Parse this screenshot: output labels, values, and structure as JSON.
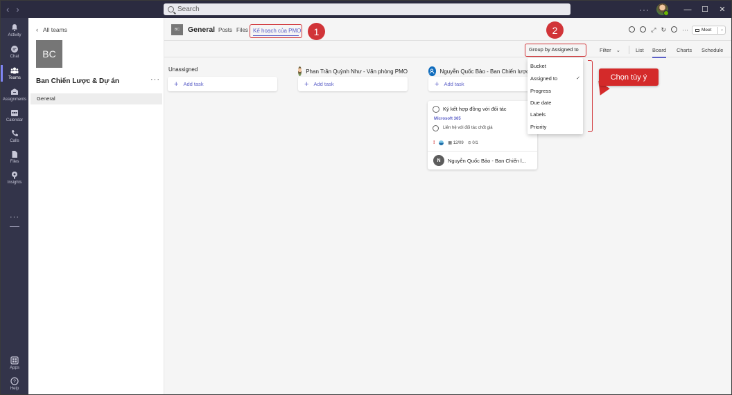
{
  "search": {
    "placeholder": "Search"
  },
  "rail": {
    "items": [
      {
        "label": "Activity",
        "icon": "bell-icon"
      },
      {
        "label": "Chat",
        "icon": "chat-icon"
      },
      {
        "label": "Teams",
        "icon": "teams-icon"
      },
      {
        "label": "Assignments",
        "icon": "assignments-icon"
      },
      {
        "label": "Calendar",
        "icon": "calendar-icon"
      },
      {
        "label": "Calls",
        "icon": "phone-icon"
      },
      {
        "label": "Files",
        "icon": "file-icon"
      },
      {
        "label": "Insights",
        "icon": "insights-icon"
      }
    ],
    "more": "···",
    "bottom": [
      {
        "label": "Apps",
        "icon": "apps-icon"
      },
      {
        "label": "Help",
        "icon": "help-icon"
      }
    ]
  },
  "teampanel": {
    "back": "All teams",
    "avatar": "BC",
    "team_name": "Ban Chiến Lược & Dự án",
    "more": "···",
    "channel": "General"
  },
  "channel": {
    "avatar": "BC",
    "title": "General",
    "tabs": {
      "posts": "Posts",
      "files": "Files",
      "plan": "Kế hoạch của PMO"
    },
    "meet": "Meet"
  },
  "annotations": {
    "step1": "1",
    "step2": "2",
    "callout": "Chọn tùy ý"
  },
  "toolbar": {
    "group_by": "Group by Assigned to",
    "filter": "Filter",
    "views": {
      "list": "List",
      "board": "Board",
      "charts": "Charts",
      "schedule": "Schedule"
    },
    "active_view": "Board"
  },
  "board": {
    "columns": [
      {
        "title": "Unassigned",
        "add": "Add task"
      },
      {
        "title": "Phan Trần Quỳnh Như - Văn phòng PMO",
        "add": "Add task"
      },
      {
        "title": "Nguyễn Quốc Bảo - Ban Chiến lược",
        "add": "Add task"
      }
    ],
    "task": {
      "title": "Ký kết hợp đồng với đối tác",
      "label": "Microsoft 365",
      "checklist_item": "Liên hệ với đối tác chốt giá",
      "priority": "!",
      "due": "12/09",
      "checklist_count": "0/1",
      "assignee_initial": "N",
      "assignee": "Nguyễn Quốc Bảo - Ban Chiến l..."
    }
  },
  "dropdown": {
    "items": [
      "Bucket",
      "Assigned to",
      "Progress",
      "Due date",
      "Labels",
      "Priority"
    ],
    "selected": "Assigned to"
  },
  "colors": {
    "accent": "#5b5fc7",
    "rail": "#33344a",
    "titlebar": "#2b2b40",
    "annotation": "#d13438"
  }
}
